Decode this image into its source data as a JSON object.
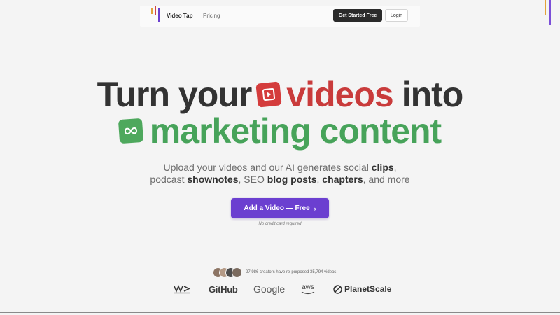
{
  "nav": {
    "brand": "Video Tap",
    "pricing": "Pricing",
    "get_started": "Get Started Free",
    "login": "Login"
  },
  "hero": {
    "line1": [
      "Turn your",
      "videos",
      "into"
    ],
    "line2": [
      "marketing content"
    ],
    "subtitle_line1": {
      "before": "Upload your videos and our AI generates social ",
      "bold1": "clips",
      "after": ","
    },
    "subtitle_line2": {
      "t1": "podcast ",
      "b1": "shownotes",
      "t2": ", SEO ",
      "b2": "blog posts",
      "t3": ", ",
      "b3": "chapters",
      "t4": ", and more"
    },
    "cta": "Add a Video — Free",
    "cta_chevron": "›",
    "no_card": "No credit card required"
  },
  "social_proof": {
    "text": "27,986 creators have re-purposed 35,794 videos"
  },
  "logos": {
    "github": "GitHub",
    "google": "Google",
    "aws": "aws",
    "planetscale": "PlanetScale"
  },
  "colors": {
    "accent": "#6b3fd0",
    "red": "#c93b3b",
    "green": "#47a35a",
    "dark_button": "#2b2b2b"
  },
  "icons": [
    "logo-bars-icon",
    "play-icon",
    "infinity-icon",
    "wm-logo-icon",
    "aws-smile-icon",
    "planetscale-icon"
  ]
}
